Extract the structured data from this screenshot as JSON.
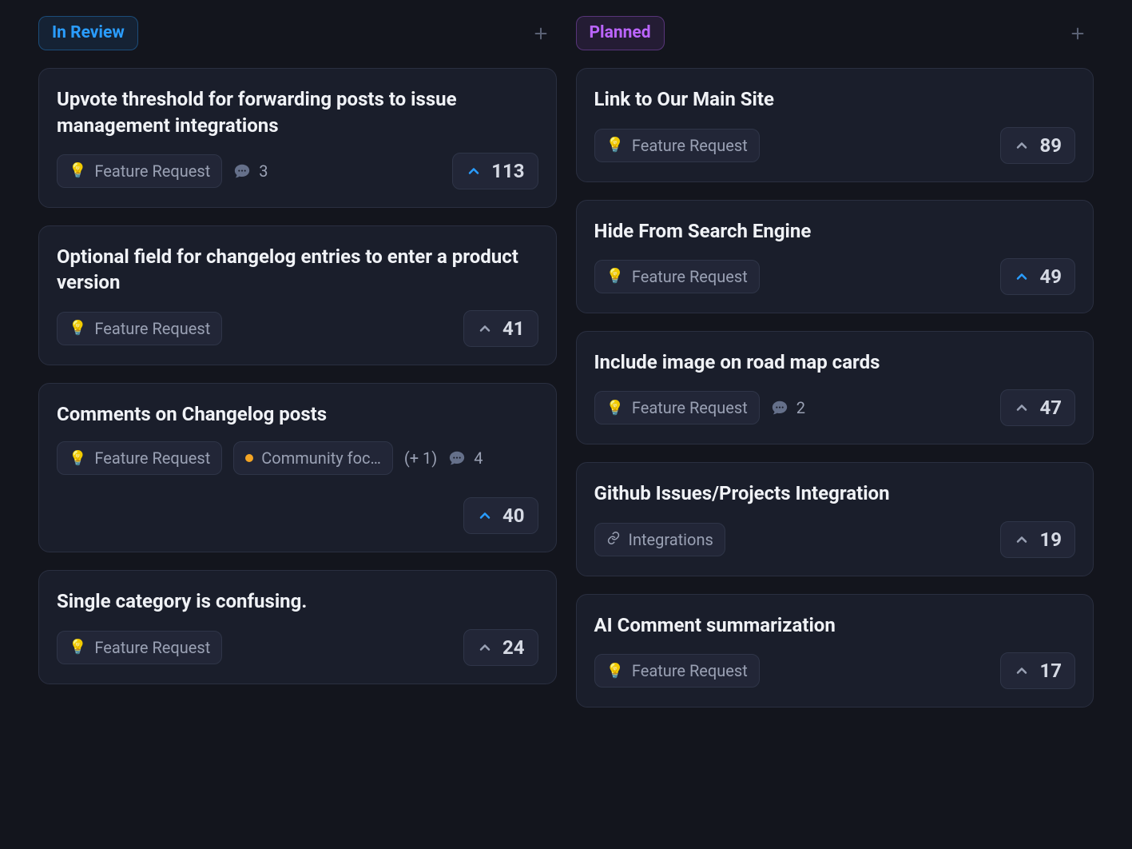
{
  "columns": [
    {
      "id": "in_review",
      "title": "In Review",
      "style": "review",
      "cards": [
        {
          "title": "Upvote threshold for forwarding posts to issue management integrations",
          "tags": [
            {
              "kind": "bulb",
              "label": "Feature Request"
            }
          ],
          "extra_tags_count": null,
          "comments": 3,
          "votes": 113,
          "voted": true,
          "break_upvote": false
        },
        {
          "title": "Optional field for changelog entries to enter a product version",
          "tags": [
            {
              "kind": "bulb",
              "label": "Feature Request"
            }
          ],
          "extra_tags_count": null,
          "comments": null,
          "votes": 41,
          "voted": false,
          "break_upvote": false
        },
        {
          "title": "Comments on Changelog posts",
          "tags": [
            {
              "kind": "bulb",
              "label": "Feature Request"
            },
            {
              "kind": "dot",
              "label": "Community foc…"
            }
          ],
          "extra_tags_count": 1,
          "comments": 4,
          "votes": 40,
          "voted": true,
          "break_upvote": true
        },
        {
          "title": "Single category is confusing.",
          "tags": [
            {
              "kind": "bulb",
              "label": "Feature Request"
            }
          ],
          "extra_tags_count": null,
          "comments": null,
          "votes": 24,
          "voted": false,
          "break_upvote": false
        }
      ]
    },
    {
      "id": "planned",
      "title": "Planned",
      "style": "planned",
      "cards": [
        {
          "title": "Link to Our Main Site",
          "tags": [
            {
              "kind": "bulb",
              "label": "Feature Request"
            }
          ],
          "extra_tags_count": null,
          "comments": null,
          "votes": 89,
          "voted": false,
          "break_upvote": false
        },
        {
          "title": "Hide From Search Engine",
          "tags": [
            {
              "kind": "bulb",
              "label": "Feature Request"
            }
          ],
          "extra_tags_count": null,
          "comments": null,
          "votes": 49,
          "voted": true,
          "break_upvote": false
        },
        {
          "title": "Include image on road map cards",
          "tags": [
            {
              "kind": "bulb",
              "label": "Feature Request"
            }
          ],
          "extra_tags_count": null,
          "comments": 2,
          "votes": 47,
          "voted": false,
          "break_upvote": false
        },
        {
          "title": "Github Issues/Projects Integration",
          "tags": [
            {
              "kind": "link",
              "label": "Integrations"
            }
          ],
          "extra_tags_count": null,
          "comments": null,
          "votes": 19,
          "voted": false,
          "break_upvote": false
        },
        {
          "title": "AI Comment summarization",
          "tags": [
            {
              "kind": "bulb",
              "label": "Feature Request"
            }
          ],
          "extra_tags_count": null,
          "comments": null,
          "votes": 17,
          "voted": false,
          "break_upvote": false
        }
      ]
    }
  ]
}
